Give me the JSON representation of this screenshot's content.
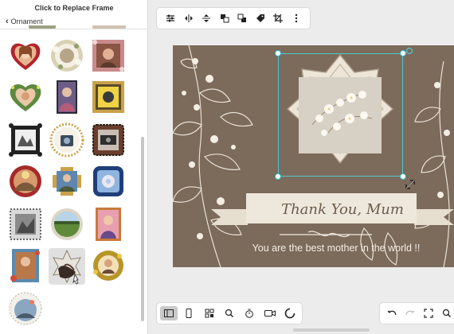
{
  "sidebar": {
    "title": "Click to Replace Frame",
    "back_label": "Ornament",
    "frames": [
      {
        "id": "heart-red",
        "selected": false
      },
      {
        "id": "round-floral-cream",
        "selected": false
      },
      {
        "id": "square-pink-floral",
        "selected": false
      },
      {
        "id": "heart-green-leaves",
        "selected": false
      },
      {
        "id": "rect-dark-portrait",
        "selected": false
      },
      {
        "id": "square-gold-ornate",
        "selected": false
      },
      {
        "id": "square-black-lace",
        "selected": false
      },
      {
        "id": "round-gold-beads",
        "selected": false
      },
      {
        "id": "square-scalloped-dark",
        "selected": false
      },
      {
        "id": "round-red-floral",
        "selected": false
      },
      {
        "id": "square-gold-cross",
        "selected": false
      },
      {
        "id": "square-blue-ornate",
        "selected": false
      },
      {
        "id": "square-grey-lace",
        "selected": false
      },
      {
        "id": "round-green-landscape",
        "selected": false
      },
      {
        "id": "rect-pink-portrait",
        "selected": false
      },
      {
        "id": "rect-blue-floral",
        "selected": false
      },
      {
        "id": "star-dark-floral",
        "selected": true
      },
      {
        "id": "round-gold-leaves",
        "selected": false
      },
      {
        "id": "round-white-lace",
        "selected": false
      }
    ]
  },
  "toolbar": {
    "icons": [
      "sliders-icon",
      "flip-horizontal-icon",
      "flip-vertical-icon",
      "bring-forward-icon",
      "send-backward-icon",
      "tag-icon",
      "crop-icon",
      "more-vertical-icon"
    ]
  },
  "canvas": {
    "background_color": "#7c6a5a",
    "heading": "Thank You, Mum",
    "subtext": "You are the best mother in the world !!"
  },
  "bottombar": {
    "icons": [
      "panel-icon",
      "device-icon",
      "layout-icon",
      "search-icon",
      "timer-icon",
      "video-icon",
      "loading-icon"
    ],
    "active_index": 0
  },
  "rightbar": {
    "icons": [
      "undo-icon",
      "redo-icon",
      "fit-screen-icon",
      "zoom-icon"
    ]
  },
  "colors": {
    "accent": "#2fb9c8",
    "canvas": "#7c6a5a",
    "ribbon": "#eee8dc"
  }
}
